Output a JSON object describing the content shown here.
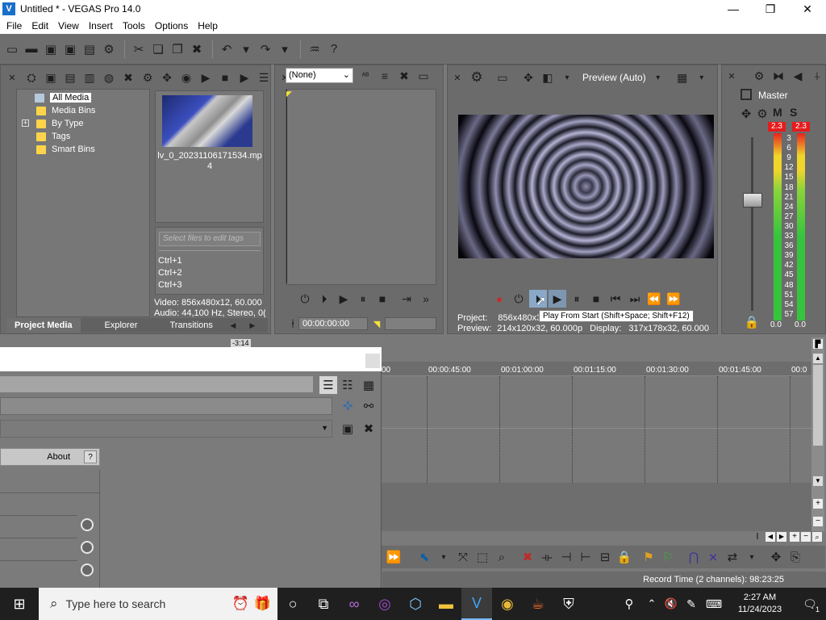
{
  "window": {
    "title": "Untitled * - VEGAS Pro 14.0",
    "controls": [
      "minimize",
      "maximize",
      "close"
    ],
    "control_glyphs": [
      "—",
      "❐",
      "✕"
    ]
  },
  "menu": {
    "items": [
      "File",
      "Edit",
      "View",
      "Insert",
      "Tools",
      "Options",
      "Help"
    ]
  },
  "project_media": {
    "tree": [
      "All Media",
      "Media Bins",
      "By Type",
      "Tags",
      "Smart Bins"
    ],
    "expander": "+",
    "thumbnail_name": "lv_0_20231106171534.mp4",
    "tag_placeholder": "Select files to edit tags",
    "shortcuts": [
      "Ctrl+1",
      "Ctrl+2",
      "Ctrl+3"
    ],
    "video_info": "Video: 856x480x12, 60.000",
    "audio_info": "Audio: 44,100 Hz, Stereo, 0(",
    "tabs": [
      "Project Media",
      "Explorer",
      "Transitions"
    ],
    "active_tab": "Project Media"
  },
  "trimmer": {
    "select_value": "(None)",
    "timecode": "00:00:00:00"
  },
  "preview": {
    "quality": "Preview (Auto)",
    "project_label": "Project:",
    "project_value": "856x480x3",
    "preview_label": "Preview:",
    "preview_value": "214x120x32, 60.000p",
    "display_label": "Display:",
    "display_value": "317x178x32, 60.000",
    "tooltip": "Play From Start (Shift+Space; Shift+F12)"
  },
  "master": {
    "label": "Master",
    "m": "M",
    "s": "S",
    "peak_left": "2.3",
    "peak_right": "2.3",
    "scale": [
      "3",
      "6",
      "9",
      "12",
      "15",
      "18",
      "21",
      "24",
      "27",
      "30",
      "33",
      "36",
      "39",
      "42",
      "45",
      "48",
      "51",
      "54",
      "57"
    ],
    "level_left": "0.0",
    "level_right": "0.0"
  },
  "timeline": {
    "cursor_time": "-3:14",
    "ruler": [
      "00",
      "00:00:45:00",
      "00:01:00:00",
      "00:01:15:00",
      "00:01:30:00",
      "00:01:45:00",
      "00:0"
    ]
  },
  "dialog": {
    "about": "About",
    "help": "?"
  },
  "status": {
    "record_time": "Record Time (2 channels): 98:23:25"
  },
  "taskbar": {
    "search_placeholder": "Type here to search",
    "time": "2:27 AM",
    "date": "11/24/2023",
    "notifications": "1"
  }
}
